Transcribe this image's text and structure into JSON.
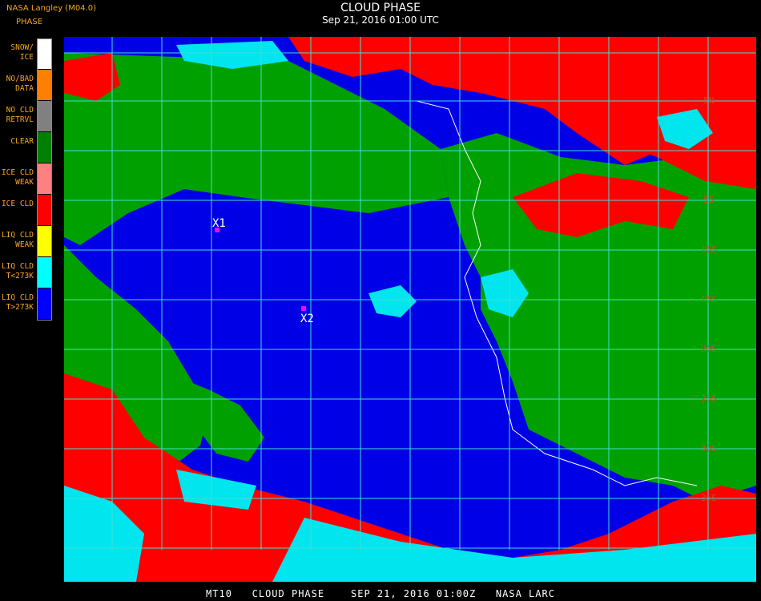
{
  "header": {
    "title": "CLOUD PHASE",
    "datetime": "Sep 21, 2016 01:00 UTC",
    "org": "NASA Langley (M04.0)",
    "legend_title": "PHASE"
  },
  "legend": [
    {
      "label": "SNOW/\nICE",
      "color": "#ffffff"
    },
    {
      "label": "NO/BAD\nDATA",
      "color": "#ff7f00"
    },
    {
      "label": "NO CLD\nRETRVL",
      "color": "#808080"
    },
    {
      "label": "CLEAR",
      "color": "#008000"
    },
    {
      "label": "ICE CLD\nWEAK",
      "color": "#ff8080"
    },
    {
      "label": "ICE CLD",
      "color": "#ff0000"
    },
    {
      "label": "LIQ CLD\nWEAK",
      "color": "#ffff00"
    },
    {
      "label": "LIQ CLD\nT<273K",
      "color": "#00ffff"
    },
    {
      "label": "LIQ CLD\nT>273K",
      "color": "#0000ff"
    }
  ],
  "map": {
    "latitude_labels": [
      "5N",
      "5S",
      "10S",
      "15S",
      "20S",
      "25S",
      "30S",
      "35S"
    ],
    "markers": [
      {
        "label": "X1"
      },
      {
        "label": "X2"
      }
    ],
    "grid_color": "#40e0d0",
    "marker_color": "#ff00ff"
  },
  "footer": "MT10   CLOUD PHASE    SEP 21, 2016 01:00Z   NASA LARC"
}
